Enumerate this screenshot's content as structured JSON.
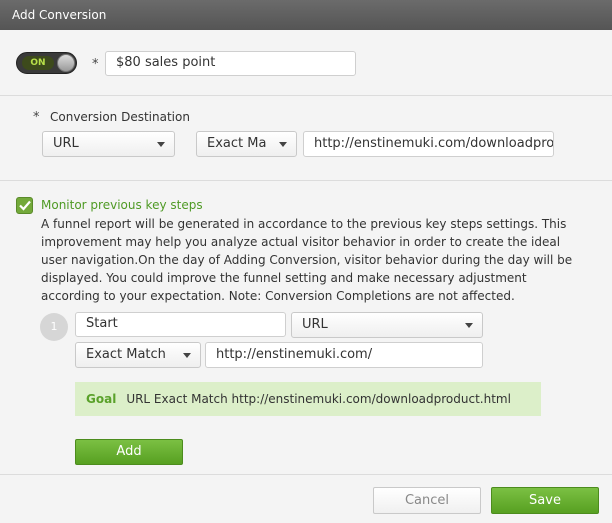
{
  "window": {
    "title": "Add Conversion"
  },
  "conversion": {
    "toggle_label": "ON",
    "required_mark": "*",
    "name_value": "$80 sales point"
  },
  "destination": {
    "required_mark": "*",
    "label": "Conversion Destination",
    "type_selected": "URL",
    "match_selected": "Exact Ma",
    "url_value": "http://enstinemuki.com/downloadpro"
  },
  "funnel": {
    "checkbox_label": "Monitor previous key steps",
    "description": "A funnel report will be generated in accordance to the previous key steps settings. This improvement may help you analyze actual visitor behavior in order to create the ideal user navigation.On the day of Adding Conversion, visitor behavior during the day will be displayed. You could improve the funnel setting and make necessary adjustment according to your expectation. Note: Conversion Completions are not affected.",
    "step": {
      "number": "1",
      "name_value": "Start",
      "type_selected": "URL",
      "match_selected": "Exact Match",
      "url_value": "http://enstinemuki.com/"
    },
    "goal": {
      "label": "Goal",
      "text": "URL Exact Match http://enstinemuki.com/downloadproduct.html"
    },
    "add_label": "Add"
  },
  "footer": {
    "cancel_label": "Cancel",
    "save_label": "Save"
  }
}
